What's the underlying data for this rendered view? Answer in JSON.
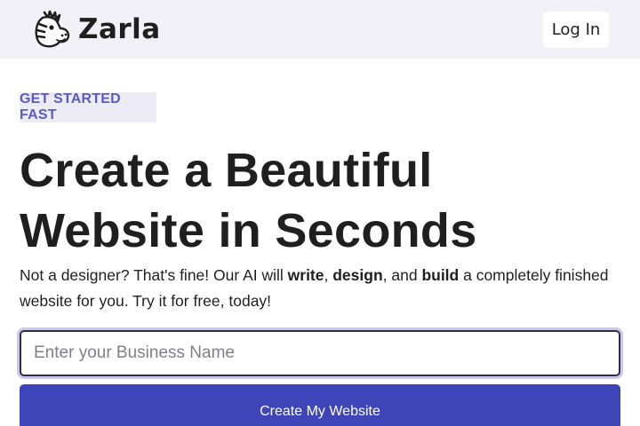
{
  "header": {
    "brand_name": "Zarla",
    "logo_icon": "zebra-head-icon",
    "login_label": "Log In"
  },
  "hero": {
    "badge": "GET STARTED FAST",
    "title_line1": "Create a Beautiful",
    "title_line2": "Website in Seconds",
    "subtitle": {
      "part1": "Not a designer? That's fine! Our AI will ",
      "bold1": "write",
      "part2": ", ",
      "bold2": "design",
      "part3": ", and ",
      "bold3": "build",
      "part4": " a completely finished website for you. Try it for free, today!"
    },
    "input_placeholder": "Enter your Business Name",
    "input_value": "",
    "cta_label": "Create My Website"
  },
  "colors": {
    "header_bg": "#f2f1f7",
    "badge_bg": "#ecebf6",
    "badge_text": "#5c5bc0",
    "cta_bg": "#3d45b8",
    "input_focus_ring": "#c9c8f3",
    "text": "#1f1f1f"
  }
}
